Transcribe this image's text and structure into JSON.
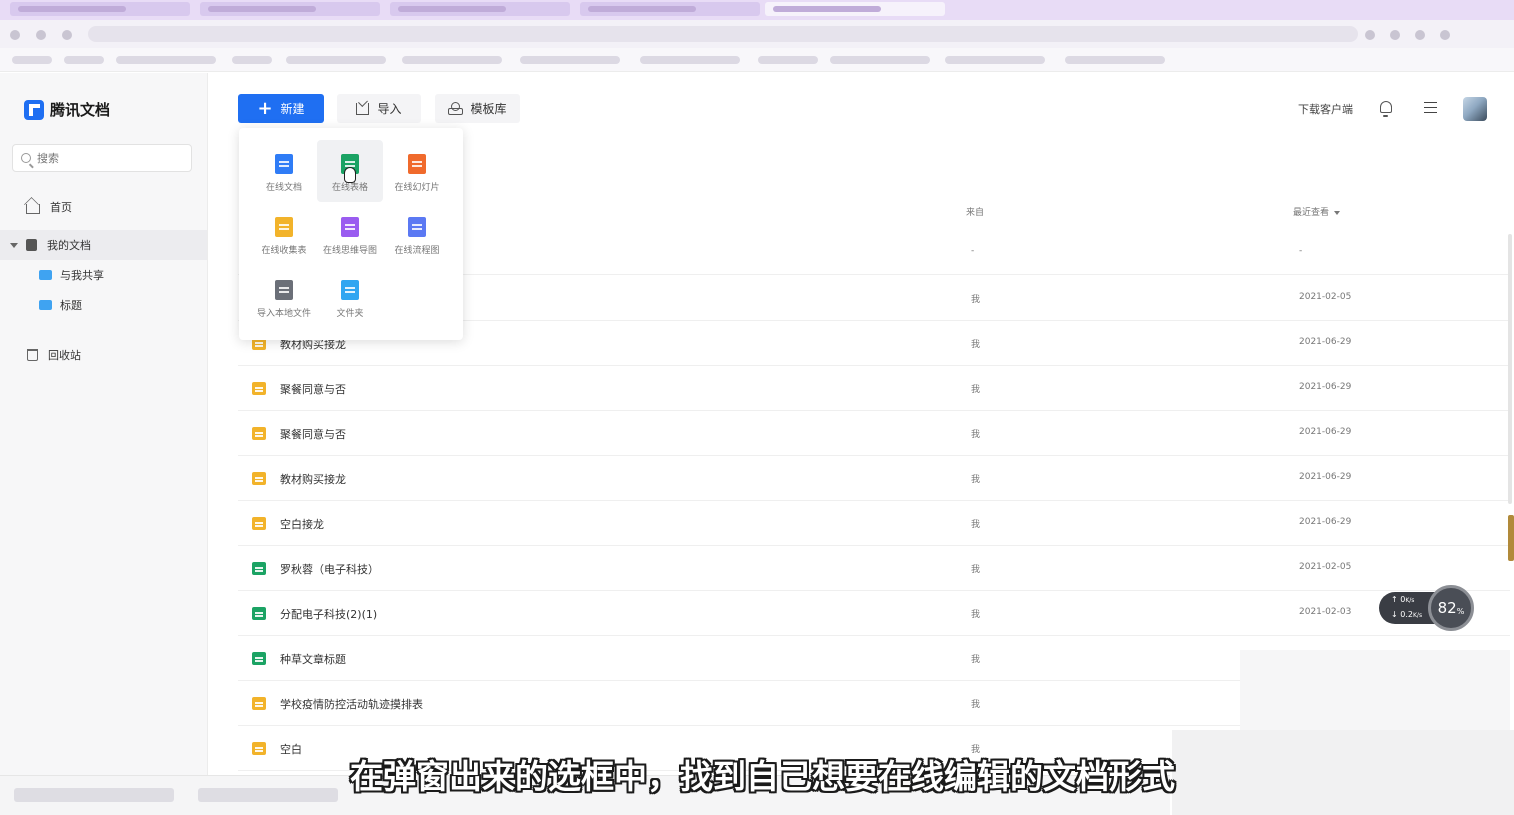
{
  "sidebar": {
    "logo_text": "腾讯文档",
    "search_placeholder": "搜索",
    "items": [
      {
        "label": "首页"
      },
      {
        "label": "我的文档"
      },
      {
        "label": "与我共享"
      },
      {
        "label": "标题"
      },
      {
        "label": "回收站"
      }
    ]
  },
  "toolbar": {
    "new_label": "新建",
    "import_label": "导入",
    "template_label": "模板库",
    "download_client": "下载客户端"
  },
  "new_menu": {
    "items": [
      {
        "label": "在线文档",
        "icon": "doc-icon",
        "color": "#2f7cf6"
      },
      {
        "label": "在线表格",
        "icon": "sheet-icon",
        "color": "#1ba364"
      },
      {
        "label": "在线幻灯片",
        "icon": "slides-icon",
        "color": "#f06a2c"
      },
      {
        "label": "在线收集表",
        "icon": "form-icon",
        "color": "#f2b32a"
      },
      {
        "label": "在线思维导图",
        "icon": "mindmap-icon",
        "color": "#9a5cf0"
      },
      {
        "label": "在线流程图",
        "icon": "flowchart-icon",
        "color": "#5b79f3"
      },
      {
        "label": "导入本地文件",
        "icon": "upload-icon",
        "color": "#6b6f78"
      },
      {
        "label": "文件夹",
        "icon": "folder-icon",
        "color": "#2fa6f1"
      }
    ]
  },
  "table": {
    "headers": {
      "source": "来自",
      "recent": "最近查看"
    },
    "rows": [
      {
        "name": "",
        "type": "form",
        "source": "-",
        "date": "-"
      },
      {
        "name": "",
        "type": "form",
        "source": "我",
        "date": "2021-02-05"
      },
      {
        "name": "教材购买接龙",
        "type": "form",
        "source": "我",
        "date": "2021-06-29"
      },
      {
        "name": "聚餐同意与否",
        "type": "form",
        "source": "我",
        "date": "2021-06-29"
      },
      {
        "name": "聚餐同意与否",
        "type": "form",
        "source": "我",
        "date": "2021-06-29"
      },
      {
        "name": "教材购买接龙",
        "type": "form",
        "source": "我",
        "date": "2021-06-29"
      },
      {
        "name": "空白接龙",
        "type": "form",
        "source": "我",
        "date": "2021-06-29"
      },
      {
        "name": "罗秋蓉（电子科技）",
        "type": "sheet",
        "source": "我",
        "date": "2021-02-05"
      },
      {
        "name": "分配电子科技(2)(1)",
        "type": "sheet",
        "source": "我",
        "date": "2021-02-03"
      },
      {
        "name": "种草文章标题",
        "type": "sheet",
        "source": "我",
        "date": ""
      },
      {
        "name": "学校疫情防控活动轨迹摸排表",
        "type": "form",
        "source": "我",
        "date": ""
      },
      {
        "name": "空白",
        "type": "form",
        "source": "我",
        "date": ""
      }
    ]
  },
  "net_widget": {
    "up": "0",
    "up_unit": "K/s",
    "down": "0.2",
    "down_unit": "K/s",
    "percent": "82",
    "percent_unit": "%"
  },
  "subtitle": "在弹窗出来的选框中，找到自己想要在线编辑的文档形式",
  "colors": {
    "accent": "#1f6ff2",
    "form": "#f2b32a",
    "sheet": "#1ba364"
  }
}
